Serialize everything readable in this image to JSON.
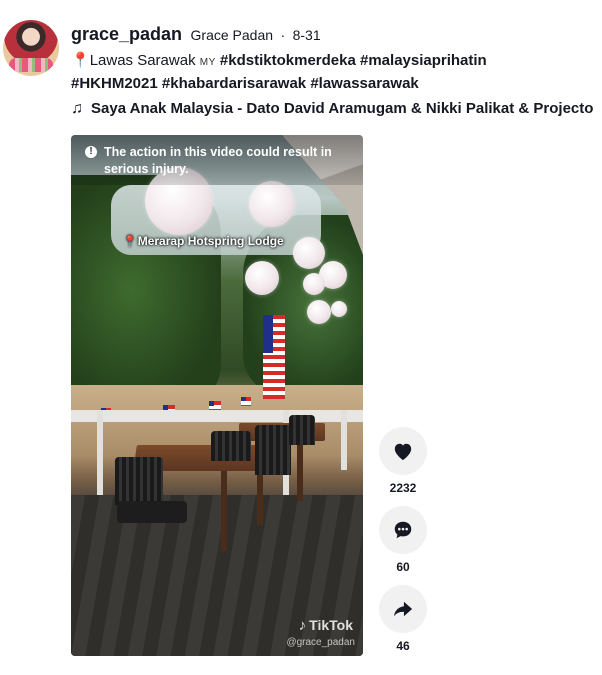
{
  "author": {
    "username": "grace_padan",
    "nickname": "Grace Padan",
    "separator": "·",
    "date": "8-31"
  },
  "description": {
    "location_text": "Lawas Sarawak",
    "flag_text": "MY",
    "hashtags_line1": [
      "#kdstiktokmerdeka",
      "#malaysiaprihatin"
    ],
    "hashtags_line2": [
      "#HKHM2021",
      "#khabardarisarawak",
      "#lawassarawak"
    ]
  },
  "music": {
    "icon": "music-note-icon",
    "title": "Saya Anak Malaysia - Dato David Aramugam & Nikki Palikat & Projecto"
  },
  "video": {
    "warning_text": "The action in this video could result in serious injury.",
    "location_sticker": "Merarap Hotspring Lodge",
    "watermark_brand": "TikTok",
    "watermark_user": "@grace_padan"
  },
  "actions": {
    "likes": "2232",
    "comments": "60",
    "shares": "46"
  },
  "colors": {
    "text": "#161823",
    "action_bg": "#f1f1f2",
    "pin": "#e0344a"
  }
}
